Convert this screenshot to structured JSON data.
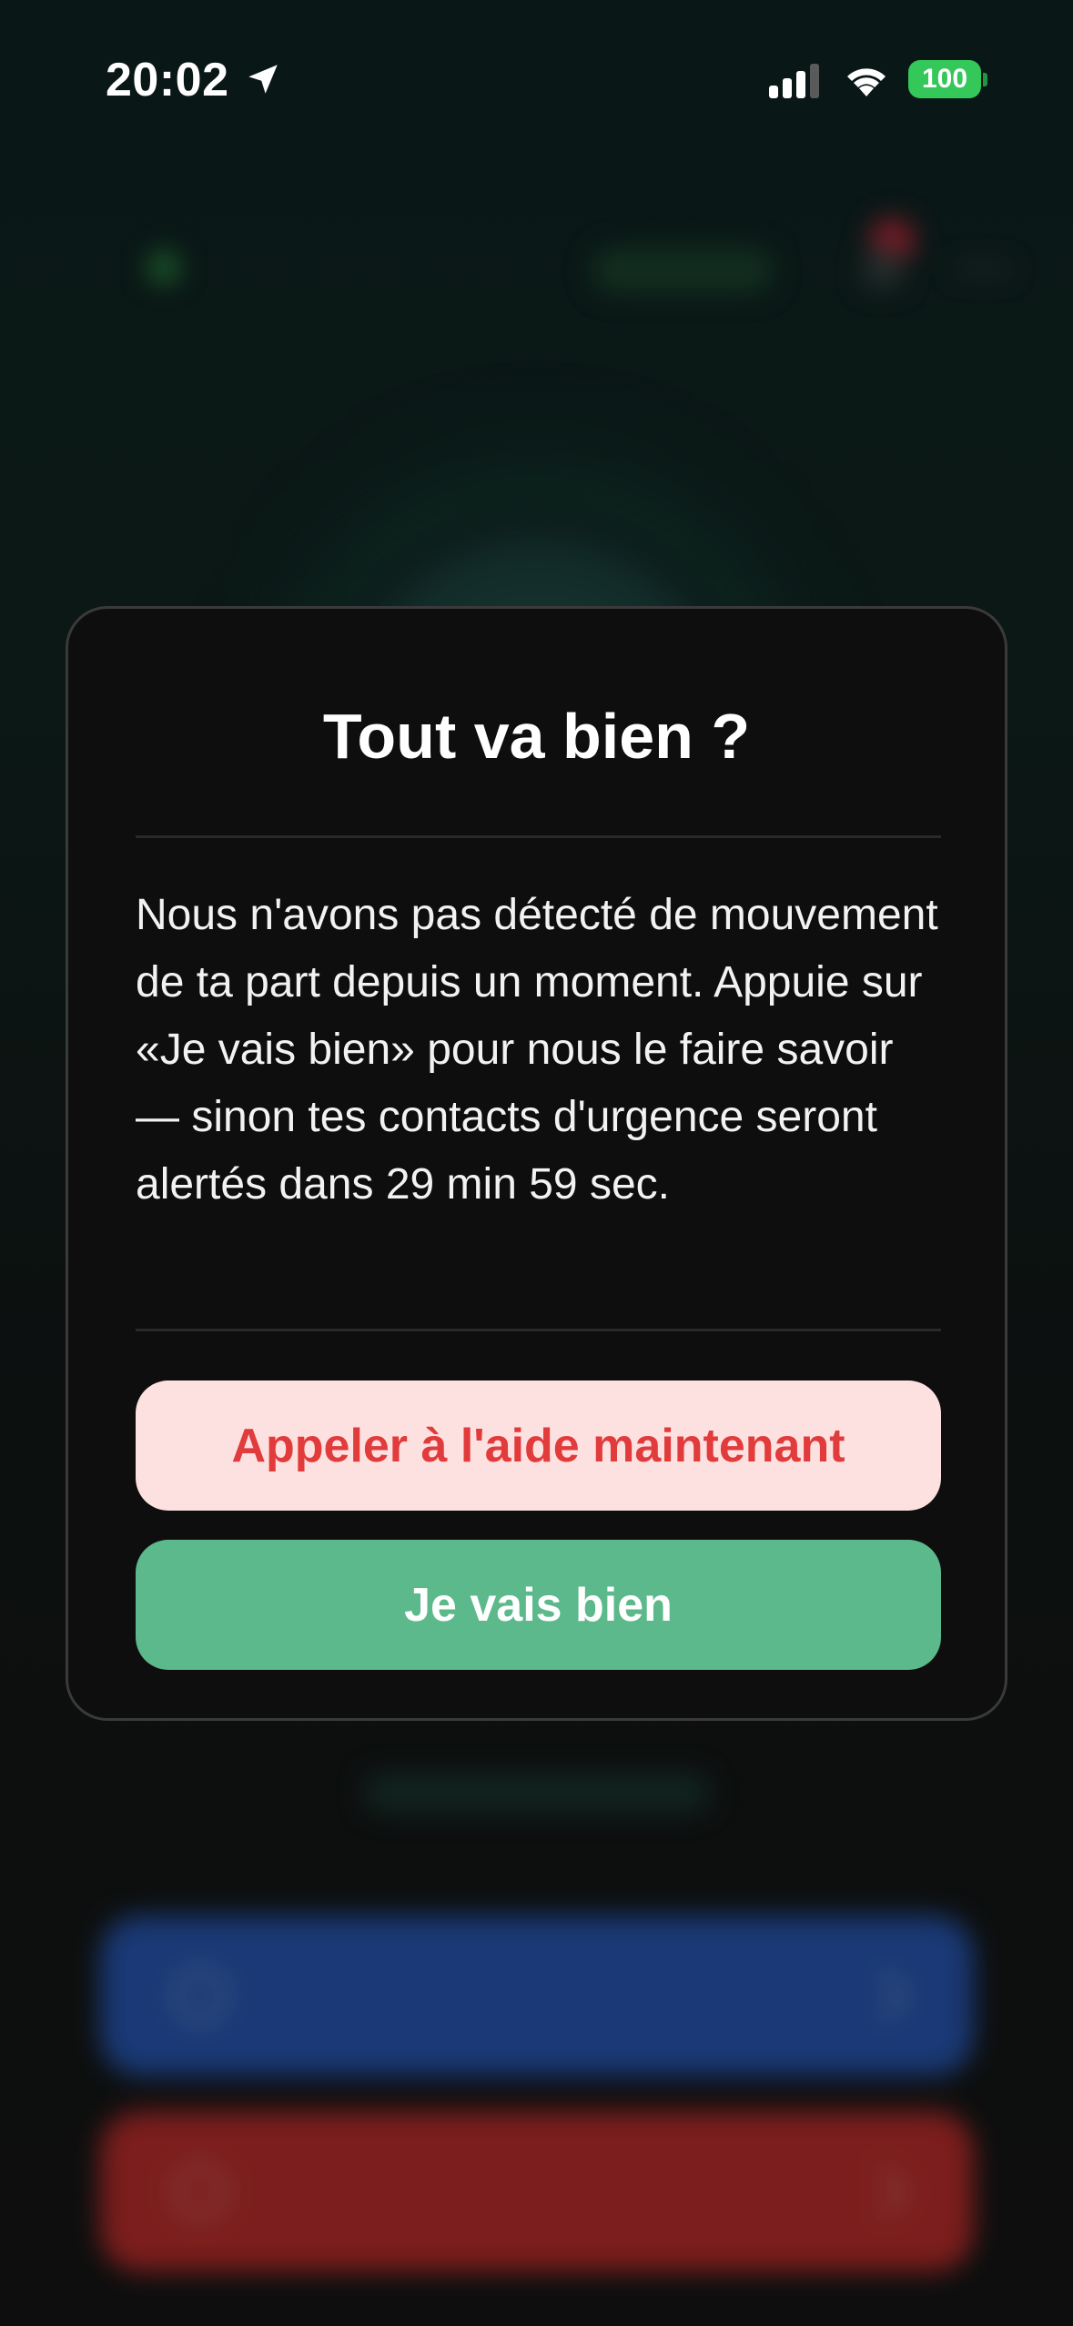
{
  "status_bar": {
    "time": "20:02",
    "battery": "100",
    "icons": [
      "location-arrow-icon",
      "cellular-signal-icon",
      "wifi-icon",
      "battery-icon"
    ]
  },
  "colors": {
    "battery": "#34c759",
    "help_button_bg": "#fde1e1",
    "help_button_text": "#e13b3b",
    "ok_button_bg": "#5cb98b",
    "modal_bg": "#0e0e0e"
  },
  "dialog": {
    "title": "Tout va bien ?",
    "message": "Nous n'avons pas détecté de mouvement de ta part depuis un moment. Appuie sur «Je vais bien» pour nous le faire savoir — sinon tes contacts d'urgence seront alertés dans 29 min 59 sec.",
    "help_button": "Appeler à l'aide maintenant",
    "ok_button": "Je vais bien"
  }
}
